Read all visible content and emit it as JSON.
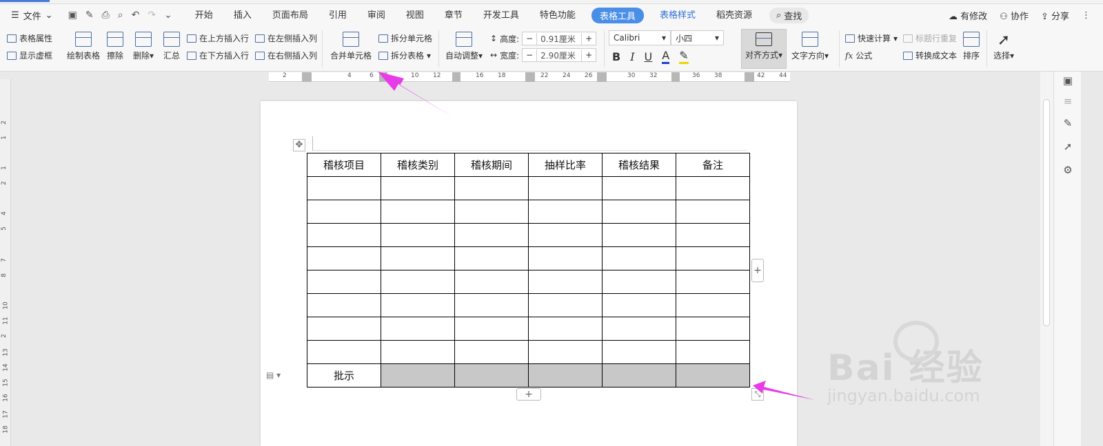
{
  "menubar": {
    "file_label": "文件",
    "tabs": [
      "开始",
      "插入",
      "页面布局",
      "引用",
      "审阅",
      "视图",
      "章节",
      "开发工具",
      "特色功能"
    ],
    "active_tab": "表格工具",
    "extra_tabs": [
      "表格样式",
      "稻壳资源"
    ],
    "search_label": "查找",
    "right_items": [
      "有修改",
      "协作",
      "分享"
    ]
  },
  "ribbon": {
    "table_props": "表格属性",
    "show_grid": "显示虚框",
    "draw_table": "绘制表格",
    "erase": "擦除",
    "delete": "删除",
    "summary": "汇总",
    "insert_above": "在上方插入行",
    "insert_below": "在下方插入行",
    "insert_left": "在左侧插入列",
    "insert_right": "在右侧插入列",
    "merge_cells": "合并单元格",
    "split_cells": "拆分单元格",
    "split_table": "拆分表格",
    "auto_fit": "自动调整",
    "height_label": "高度:",
    "height_value": "0.91厘米",
    "width_label": "宽度:",
    "width_value": "2.90厘米",
    "font_name": "Calibri",
    "font_size": "小四",
    "align_label": "对齐方式",
    "text_direction": "文字方向",
    "quick_calc": "快速计算",
    "formula": "公式",
    "title_repeat": "标题行重复",
    "convert_text": "转换成文本",
    "sort": "排序",
    "select": "选择"
  },
  "ruler": {
    "h_labels": [
      "2",
      "4",
      "6",
      "10",
      "12",
      "16",
      "18",
      "22",
      "24",
      "26",
      "30",
      "32",
      "36",
      "38",
      "42",
      "44"
    ],
    "v_labels": [
      "2",
      "1",
      "1",
      "2",
      "4",
      "5",
      "7",
      "8",
      "10",
      "11",
      "2",
      "13",
      "14",
      "15",
      "16",
      "17",
      "18"
    ]
  },
  "table": {
    "headers": [
      "稽核项目",
      "稽核类别",
      "稽核期间",
      "抽样比率",
      "稽核结果",
      "备注"
    ],
    "empty_rows": 8,
    "last_row_label": "批示"
  },
  "watermark": {
    "brand": "Bai 经验",
    "url": "jingyan.baidu.com"
  },
  "colors": {
    "accent": "#4a8fe7",
    "arrow": "#e83ce8",
    "shade": "#c8c8c8"
  }
}
